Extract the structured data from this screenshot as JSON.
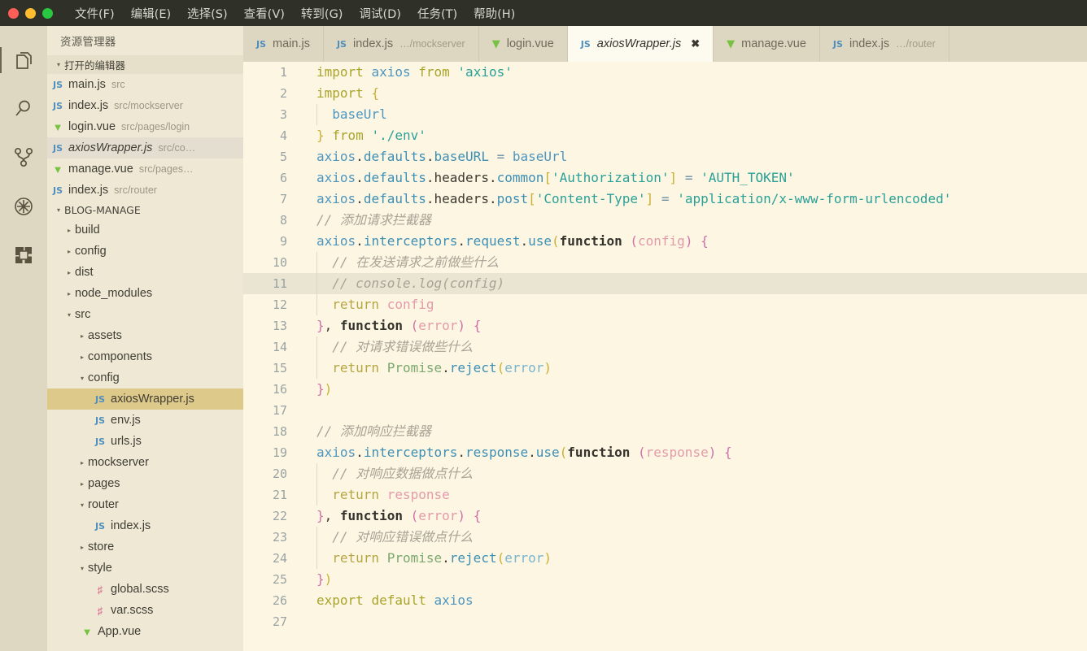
{
  "window": {
    "traffic_lights": [
      "close",
      "minimize",
      "maximize"
    ],
    "menu": [
      {
        "label": "文件(F)"
      },
      {
        "label": "编辑(E)"
      },
      {
        "label": "选择(S)"
      },
      {
        "label": "查看(V)"
      },
      {
        "label": "转到(G)"
      },
      {
        "label": "调试(D)"
      },
      {
        "label": "任务(T)"
      },
      {
        "label": "帮助(H)"
      }
    ]
  },
  "activitybar": {
    "items": [
      {
        "name": "explorer-icon",
        "title": "资源管理器",
        "active": true
      },
      {
        "name": "search-icon",
        "title": "搜索",
        "active": false
      },
      {
        "name": "source-control-icon",
        "title": "源代码管理",
        "active": false
      },
      {
        "name": "debug-icon",
        "title": "调试",
        "active": false
      },
      {
        "name": "extensions-icon",
        "title": "扩展",
        "active": false
      }
    ]
  },
  "sidebar": {
    "title": "资源管理器",
    "open_editors": {
      "label": "打开的编辑器",
      "expanded": true,
      "items": [
        {
          "name": "main.js",
          "path": "src",
          "icon": "js",
          "active": false
        },
        {
          "name": "index.js",
          "path": "src/mockserver",
          "icon": "js",
          "active": false
        },
        {
          "name": "login.vue",
          "path": "src/pages/login",
          "icon": "vue",
          "active": false
        },
        {
          "name": "axiosWrapper.js",
          "path": "src/co…",
          "icon": "js",
          "active": true,
          "italic": true
        },
        {
          "name": "manage.vue",
          "path": "src/pages…",
          "icon": "vue",
          "active": false
        },
        {
          "name": "index.js",
          "path": "src/router",
          "icon": "js",
          "active": false
        }
      ]
    },
    "project": {
      "label": "BLOG-MANAGE",
      "expanded": true,
      "items": [
        {
          "label": "build",
          "type": "folder",
          "state": "closed",
          "depth": 1
        },
        {
          "label": "config",
          "type": "folder",
          "state": "closed",
          "depth": 1
        },
        {
          "label": "dist",
          "type": "folder",
          "state": "closed",
          "depth": 1
        },
        {
          "label": "node_modules",
          "type": "folder",
          "state": "closed",
          "depth": 1
        },
        {
          "label": "src",
          "type": "folder",
          "state": "open",
          "depth": 1
        },
        {
          "label": "assets",
          "type": "folder",
          "state": "closed",
          "depth": 2
        },
        {
          "label": "components",
          "type": "folder",
          "state": "closed",
          "depth": 2
        },
        {
          "label": "config",
          "type": "folder",
          "state": "open",
          "depth": 2
        },
        {
          "label": "axiosWrapper.js",
          "type": "file",
          "icon": "js",
          "depth": 3,
          "selected": true
        },
        {
          "label": "env.js",
          "type": "file",
          "icon": "js",
          "depth": 3
        },
        {
          "label": "urls.js",
          "type": "file",
          "icon": "js",
          "depth": 3
        },
        {
          "label": "mockserver",
          "type": "folder",
          "state": "closed",
          "depth": 2
        },
        {
          "label": "pages",
          "type": "folder",
          "state": "closed",
          "depth": 2
        },
        {
          "label": "router",
          "type": "folder",
          "state": "open",
          "depth": 2
        },
        {
          "label": "index.js",
          "type": "file",
          "icon": "js",
          "depth": 3
        },
        {
          "label": "store",
          "type": "folder",
          "state": "closed",
          "depth": 2
        },
        {
          "label": "style",
          "type": "folder",
          "state": "open",
          "depth": 2
        },
        {
          "label": "global.scss",
          "type": "file",
          "icon": "scss",
          "depth": 3
        },
        {
          "label": "var.scss",
          "type": "file",
          "icon": "scss",
          "depth": 3
        },
        {
          "label": "App.vue",
          "type": "file",
          "icon": "vue",
          "depth": 2
        }
      ]
    }
  },
  "tabs": [
    {
      "label": "main.js",
      "desc": "",
      "icon": "js",
      "active": false,
      "closeable": false
    },
    {
      "label": "index.js",
      "desc": "…/mockserver",
      "icon": "js",
      "active": false,
      "closeable": false
    },
    {
      "label": "login.vue",
      "desc": "",
      "icon": "vue",
      "active": false,
      "closeable": false
    },
    {
      "label": "axiosWrapper.js",
      "desc": "",
      "icon": "js",
      "active": true,
      "closeable": true,
      "close_glyph": "✖"
    },
    {
      "label": "manage.vue",
      "desc": "",
      "icon": "vue",
      "active": false,
      "closeable": false
    },
    {
      "label": "index.js",
      "desc": "…/router",
      "icon": "js",
      "active": false,
      "closeable": false
    }
  ],
  "editor": {
    "filename": "axiosWrapper.js",
    "language": "javascript",
    "highlighted_line": 11,
    "first_line": 1,
    "last_line": 27,
    "lines": [
      {
        "n": 1,
        "indent": 0,
        "text": "import axios from 'axios'"
      },
      {
        "n": 2,
        "indent": 0,
        "text": "import {"
      },
      {
        "n": 3,
        "indent": 1,
        "text": "  baseUrl"
      },
      {
        "n": 4,
        "indent": 0,
        "text": "} from './env'"
      },
      {
        "n": 5,
        "indent": 0,
        "text": "axios.defaults.baseURL = baseUrl"
      },
      {
        "n": 6,
        "indent": 0,
        "text": "axios.defaults.headers.common['Authorization'] = 'AUTH_TOKEN'"
      },
      {
        "n": 7,
        "indent": 0,
        "text": "axios.defaults.headers.post['Content-Type'] = 'application/x-www-form-urlencoded'"
      },
      {
        "n": 8,
        "indent": 0,
        "text": "// 添加请求拦截器"
      },
      {
        "n": 9,
        "indent": 0,
        "text": "axios.interceptors.request.use(function (config) {"
      },
      {
        "n": 10,
        "indent": 1,
        "text": "  // 在发送请求之前做些什么"
      },
      {
        "n": 11,
        "indent": 1,
        "text": "  // console.log(config)"
      },
      {
        "n": 12,
        "indent": 1,
        "text": "  return config"
      },
      {
        "n": 13,
        "indent": 0,
        "text": "}, function (error) {"
      },
      {
        "n": 14,
        "indent": 1,
        "text": "  // 对请求错误做些什么"
      },
      {
        "n": 15,
        "indent": 1,
        "text": "  return Promise.reject(error)"
      },
      {
        "n": 16,
        "indent": 0,
        "text": "})"
      },
      {
        "n": 17,
        "indent": 0,
        "text": ""
      },
      {
        "n": 18,
        "indent": 0,
        "text": "// 添加响应拦截器"
      },
      {
        "n": 19,
        "indent": 0,
        "text": "axios.interceptors.response.use(function (response) {"
      },
      {
        "n": 20,
        "indent": 1,
        "text": "  // 对响应数据做点什么"
      },
      {
        "n": 21,
        "indent": 1,
        "text": "  return response"
      },
      {
        "n": 22,
        "indent": 0,
        "text": "}, function (error) {"
      },
      {
        "n": 23,
        "indent": 1,
        "text": "  // 对响应错误做点什么"
      },
      {
        "n": 24,
        "indent": 1,
        "text": "  return Promise.reject(error)"
      },
      {
        "n": 25,
        "indent": 0,
        "text": "})"
      },
      {
        "n": 26,
        "indent": 0,
        "text": "export default axios"
      },
      {
        "n": 27,
        "indent": 0,
        "text": ""
      }
    ]
  },
  "colors": {
    "titlebar_bg": "#2f3129",
    "activitybar_bg": "#ded8c3",
    "sidebar_bg": "#eee8d5",
    "editor_bg": "#fdf6e3",
    "tabbar_bg": "#ddd6c1",
    "active_tab_bg": "#fdfaf0",
    "selection_bg": "#ddc98a",
    "current_line_bg": "#eae4d2",
    "comment": "#a7a396",
    "string": "#2aa198",
    "keyword": "#a9a42c",
    "identifier": "#4d96c0"
  }
}
